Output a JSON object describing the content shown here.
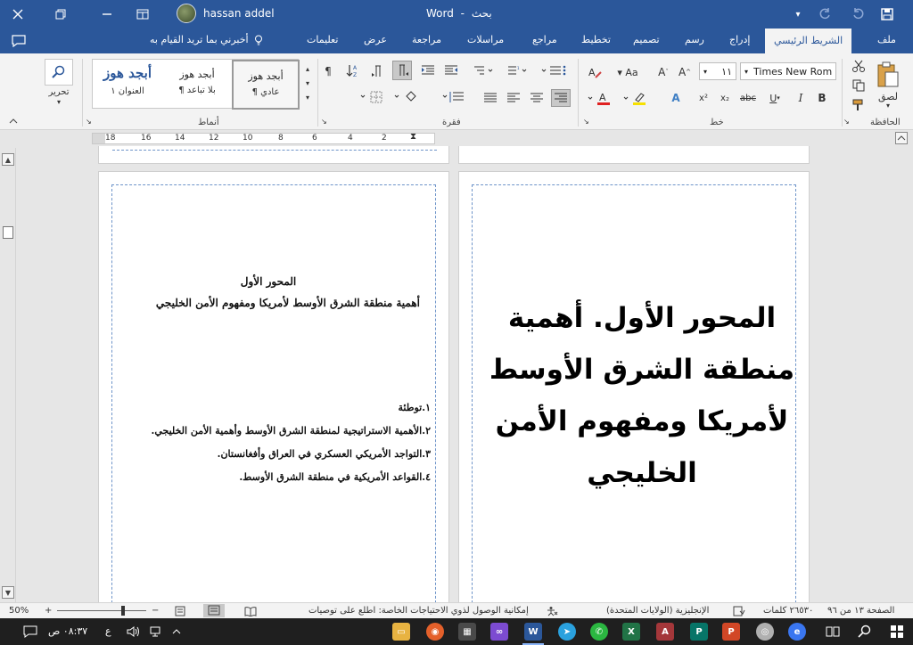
{
  "titlebar": {
    "username": "hassan addel",
    "app_title": "Word",
    "separator": "-",
    "search_label": "بحث"
  },
  "tabs": [
    {
      "label": "ملف"
    },
    {
      "label": "الشريط الرئيسي"
    },
    {
      "label": "إدراج"
    },
    {
      "label": "رسم"
    },
    {
      "label": "تصميم"
    },
    {
      "label": "تخطيط"
    },
    {
      "label": "مراجع"
    },
    {
      "label": "مراسلات"
    },
    {
      "label": "مراجعة"
    },
    {
      "label": "عرض"
    },
    {
      "label": "تعليمات"
    },
    {
      "label": "أخبرني بما تريد القيام به"
    }
  ],
  "ribbon": {
    "clipboard": {
      "label": "الحافظة",
      "paste": "لصق"
    },
    "font": {
      "label": "خط",
      "font_name": "Times New Rom",
      "font_size": "١١"
    },
    "paragraph": {
      "label": "فقرة"
    },
    "styles": {
      "label": "أنماط",
      "items": [
        {
          "sample": "أبجد هوز",
          "name": "¶ عادي"
        },
        {
          "sample": "أبجد هوز",
          "name": "¶ بلا تباعد"
        },
        {
          "sample": "أبجد هوز",
          "name": "العنوان ١"
        }
      ]
    },
    "editing": {
      "label": "تحرير"
    }
  },
  "ruler": {
    "ticks": [
      "18",
      "16",
      "14",
      "12",
      "10",
      "8",
      "6",
      "4",
      "2"
    ]
  },
  "document": {
    "left_page": {
      "heading": "المحور الأول",
      "subheading": "أهمية منطقة الشرق الأوسط لأمريكا ومفهوم الأمن الخليجي",
      "list": [
        "١.توطئة",
        "٢.الأهمية الاستراتيجية لمنطقة الشرق الأوسط وأهمية الأمن الخليجي.",
        "٣.التواجد الأمريكي العسكري في العراق وأفغانستان.",
        "٤.القواعد الأمريكية في منطقة الشرق الأوسط."
      ]
    },
    "right_page": {
      "title": "المحور الأول. أهمية منطقة الشرق الأوسط لأمريكا ومفهوم الأمن الخليجي"
    }
  },
  "statusbar": {
    "page": "الصفحة ١٣ من ٩٦",
    "words": "٢٦٥٣٠ كلمات",
    "language": "الإنجليزية (الولايات المتحدة)",
    "accessibility": "إمكانية الوصول لذوي الاحتياجات الخاصة: اطلع على توصيات",
    "zoom": "50%"
  },
  "taskbar": {
    "time": "٠٨:٣٧ ص",
    "lang": "ع"
  }
}
